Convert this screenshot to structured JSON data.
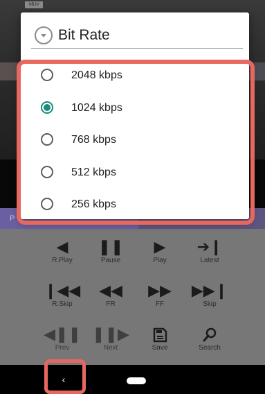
{
  "background": {
    "video_badge": "NBJV",
    "progress_letter": "P"
  },
  "dialog": {
    "title": "Bit Rate",
    "title_icon": "chevron-circle-down-icon",
    "options": [
      {
        "label": "2048 kbps",
        "selected": false
      },
      {
        "label": "1024 kbps",
        "selected": true
      },
      {
        "label": "768 kbps",
        "selected": false
      },
      {
        "label": "512 kbps",
        "selected": false
      },
      {
        "label": "256 kbps",
        "selected": false
      }
    ]
  },
  "controls": [
    {
      "label": "R.Play",
      "icon": "reverse-play-icon"
    },
    {
      "label": "Pause",
      "icon": "pause-icon"
    },
    {
      "label": "Play",
      "icon": "play-icon"
    },
    {
      "label": "Latest",
      "icon": "latest-icon"
    },
    {
      "label": "R.Skip",
      "icon": "reverse-skip-icon"
    },
    {
      "label": "FR",
      "icon": "fast-reverse-icon"
    },
    {
      "label": "FF",
      "icon": "fast-forward-icon"
    },
    {
      "label": "Skip",
      "icon": "skip-icon"
    },
    {
      "label": "Prev",
      "icon": "previous-frame-icon"
    },
    {
      "label": "Next",
      "icon": "next-frame-icon"
    },
    {
      "label": "Save",
      "icon": "save-icon"
    },
    {
      "label": "Search",
      "icon": "search-icon"
    }
  ],
  "nav": {
    "back_glyph": "‹"
  },
  "colors": {
    "accent": "#1a8a7a",
    "highlight": "#e8675f"
  }
}
